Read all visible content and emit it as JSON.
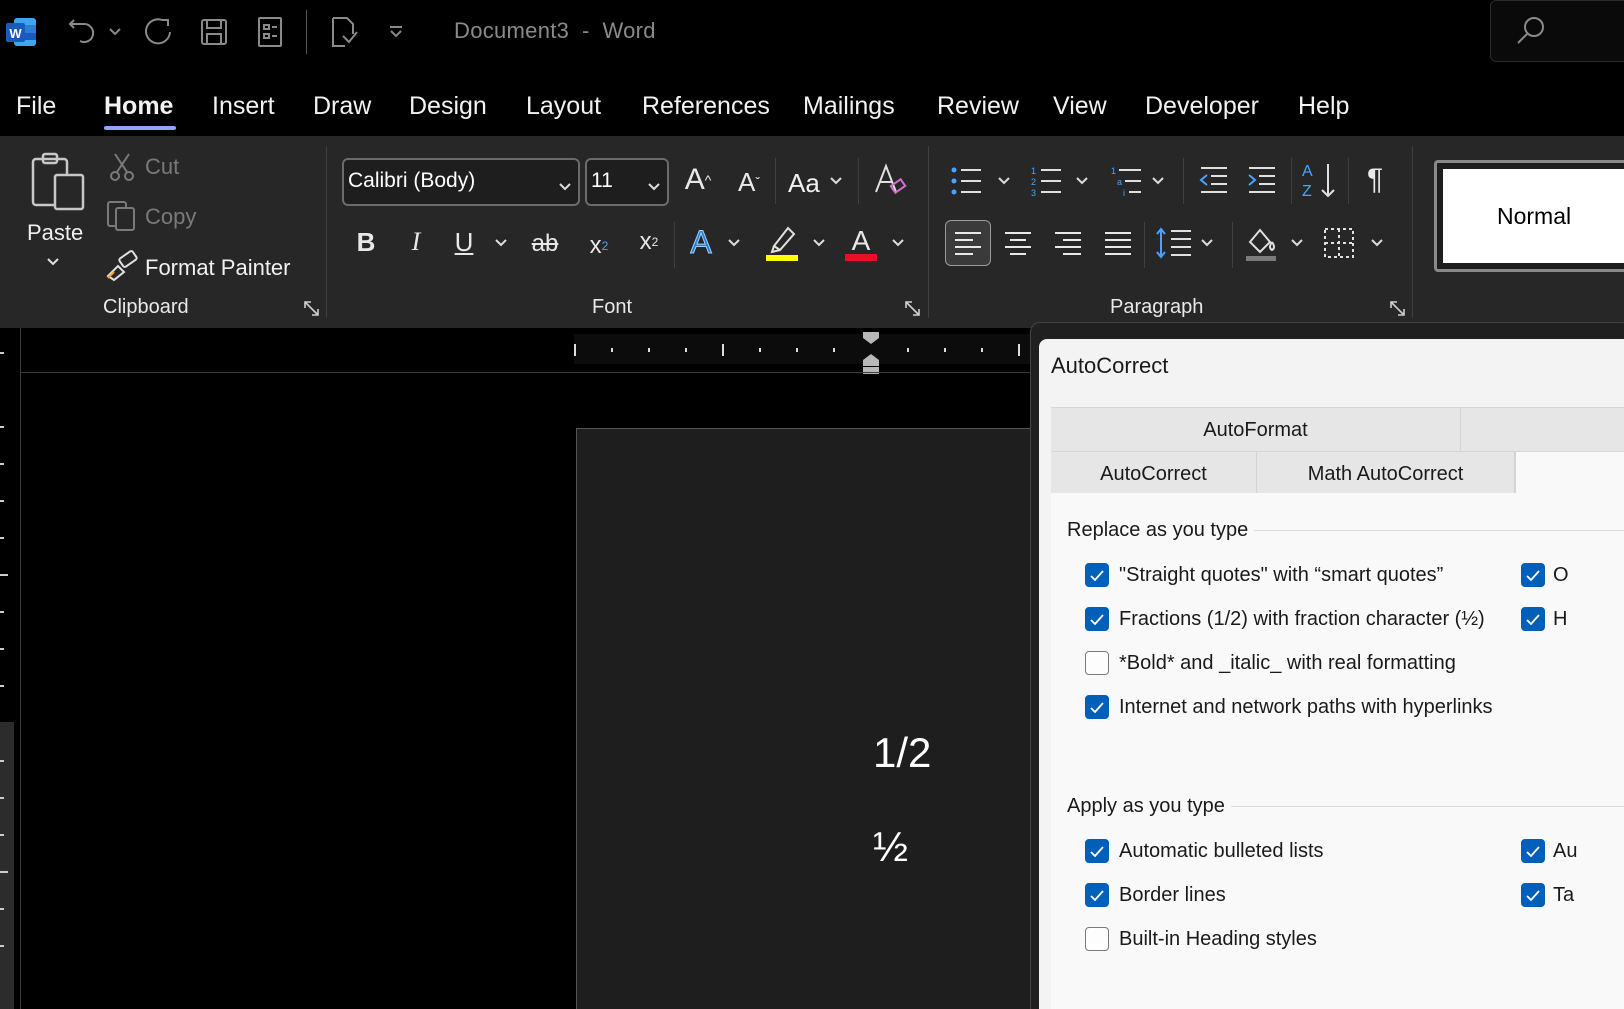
{
  "title_bar": {
    "title": "Document3  -  Word",
    "icons": [
      "word-logo-icon",
      "undo-icon",
      "undo-dropdown-icon",
      "redo-icon",
      "save-icon",
      "form-icon",
      "print-preview-icon",
      "customize-qat-icon",
      "search-icon"
    ]
  },
  "menu": {
    "tabs": [
      "File",
      "Home",
      "Insert",
      "Draw",
      "Design",
      "Layout",
      "References",
      "Mailings",
      "Review",
      "View",
      "Developer",
      "Help"
    ],
    "active": "Home"
  },
  "ribbon": {
    "clipboard": {
      "paste": "Paste",
      "cut": "Cut",
      "copy": "Copy",
      "format_painter": "Format Painter",
      "group_label": "Clipboard"
    },
    "font": {
      "font_name": "Calibri (Body)",
      "font_size": "11",
      "change_case": "Aa",
      "group_label": "Font",
      "highlight_color": "#ffff00",
      "font_color": "#e81123"
    },
    "paragraph": {
      "group_label": "Paragraph"
    },
    "styles": {
      "normal": "Normal"
    }
  },
  "document": {
    "line1": "1/2",
    "line2": "½"
  },
  "dialog": {
    "title": "AutoCorrect",
    "tabs_row1": [
      "AutoFormat"
    ],
    "tabs_row2": [
      "AutoCorrect",
      "Math AutoCorrect"
    ],
    "replace_section": "Replace as you type",
    "replace_items": [
      {
        "label": "\"Straight quotes\" with “smart quotes”",
        "checked": true
      },
      {
        "label": "Fractions (1/2) with fraction character (½)",
        "checked": true
      },
      {
        "label": "*Bold* and _italic_ with real formatting",
        "checked": false
      },
      {
        "label": "Internet and network paths with hyperlinks",
        "checked": true
      }
    ],
    "replace_right": [
      {
        "label": "O",
        "checked": true
      },
      {
        "label": "H",
        "checked": true
      }
    ],
    "apply_section": "Apply as you type",
    "apply_items": [
      {
        "label": "Automatic bulleted lists",
        "checked": true
      },
      {
        "label": "Border lines",
        "checked": true
      },
      {
        "label": "Built-in Heading styles",
        "checked": false
      }
    ],
    "apply_right": [
      {
        "label": "Au",
        "checked": true
      },
      {
        "label": "Ta",
        "checked": true
      }
    ]
  },
  "colors": {
    "accent": "#005fb8",
    "menu_underline": "#8fa3ff"
  }
}
